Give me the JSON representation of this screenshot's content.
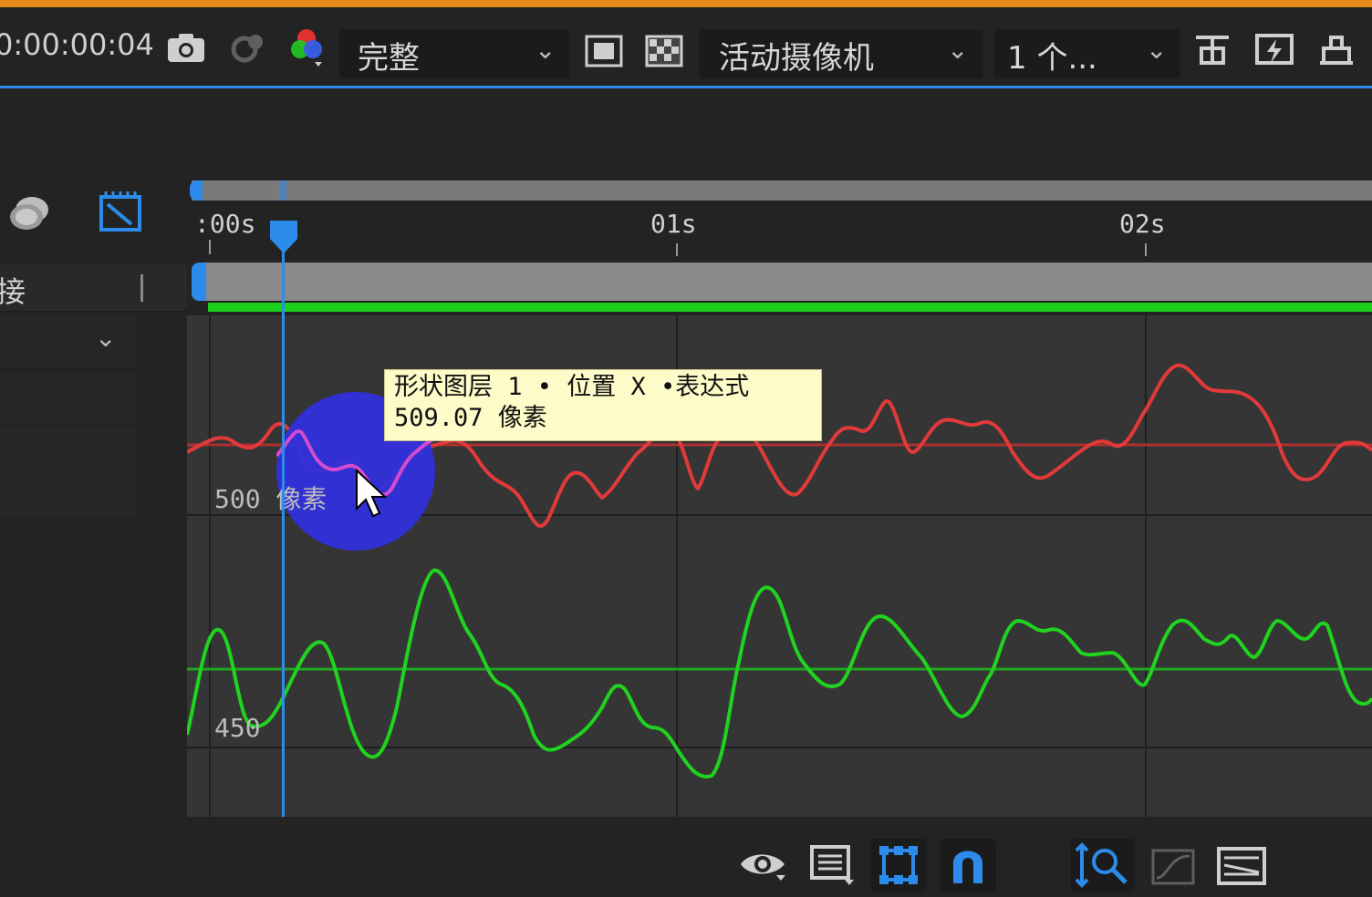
{
  "toolbar": {
    "timecode": "0:00:00:04",
    "resolution_label": "完整",
    "camera_label": "活动摄像机",
    "view_count_label": "1 个..."
  },
  "left_panel": {
    "row_label": "接"
  },
  "ruler": {
    "ticks": [
      ":00s",
      "01s",
      "02s"
    ]
  },
  "tooltip": {
    "line1": "形状图层 1 • 位置 X •表达式",
    "line2": "509.07 像素"
  },
  "graph": {
    "axis_labels": {
      "upper": "500 像素",
      "lower": "450"
    },
    "colors": {
      "red_curve": "#e23a3a",
      "green_curve": "#1fd31f",
      "playhead": "#2d8ceb",
      "cursor_highlight": "#2f2fd8"
    }
  },
  "icons": {
    "snapshot": "camera-icon",
    "show_snapshot": "snapshot-icon",
    "channels": "rgb-channels-icon",
    "region": "region-of-interest-icon",
    "transparency": "transparency-grid-icon",
    "layout": "layout-icon",
    "fast_preview": "fast-preview-icon",
    "flowchart": "flowchart-icon",
    "shy": "shy-layers-icon",
    "graph_editor": "graph-editor-icon",
    "eye": "eye-icon",
    "list": "list-icon",
    "transform_box": "transform-box-icon",
    "snapping": "snapping-magnet-icon",
    "fit": "fit-zoom-icon",
    "graph_type": "graph-type-icon",
    "separate": "separate-dimensions-icon"
  }
}
